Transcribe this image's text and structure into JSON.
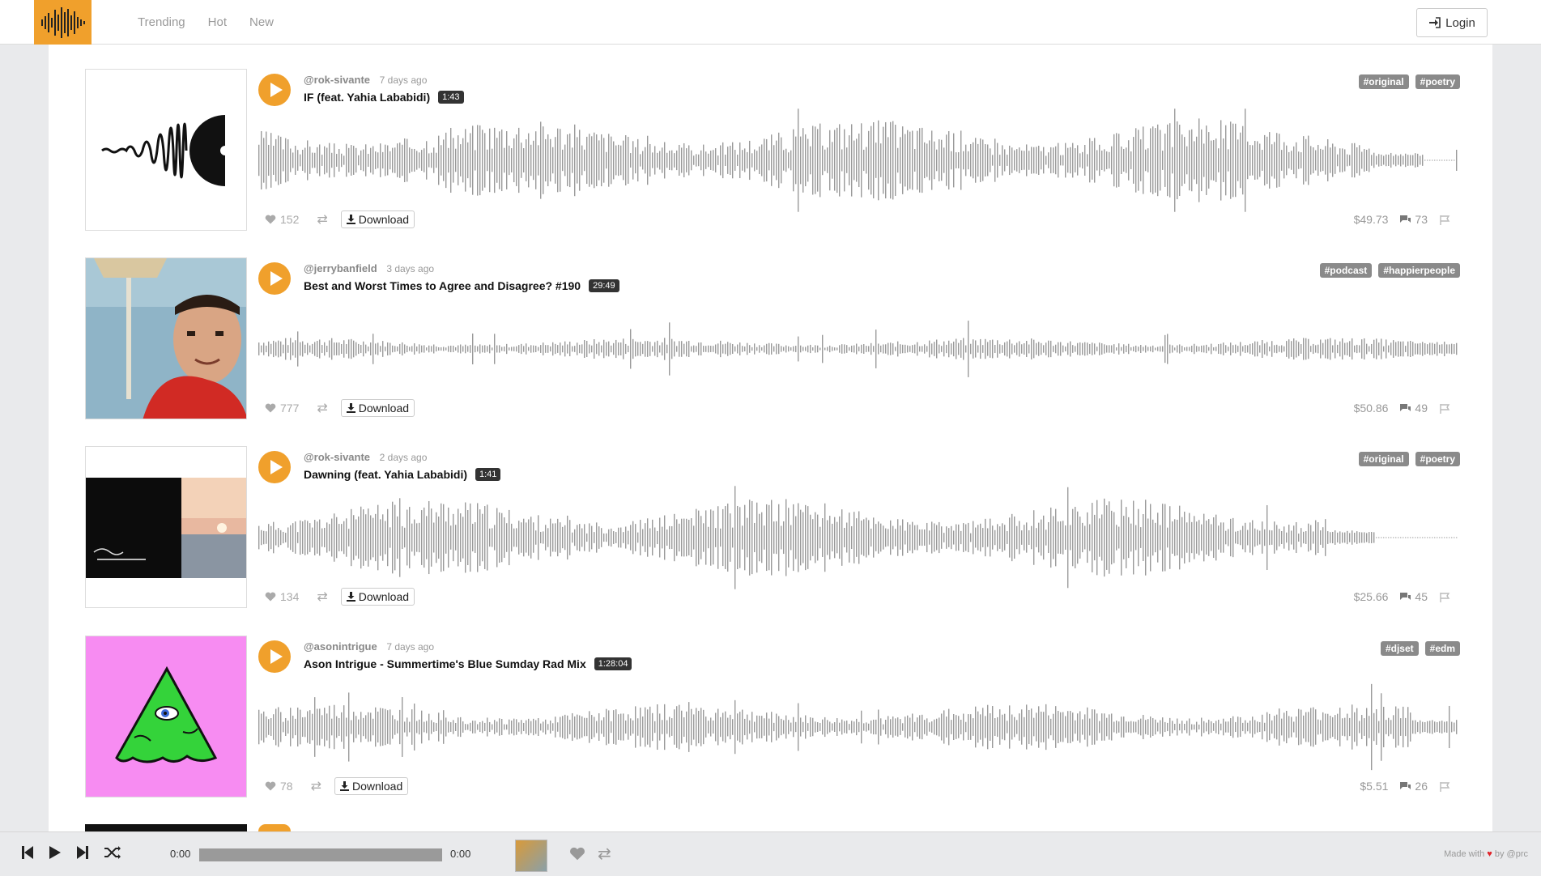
{
  "nav": {
    "items": [
      "Trending",
      "Hot",
      "New"
    ],
    "login_label": "Login"
  },
  "tracks": [
    {
      "author": "@rok-sivante",
      "ago": "7 days ago",
      "title": "IF (feat. Yahia Lababidi)",
      "duration": "1:43",
      "tags": [
        "#original",
        "#poetry"
      ],
      "likes": "152",
      "payout": "$49.73",
      "comments": "73",
      "download_label": "Download",
      "cover": "vinyl-waveform-art"
    },
    {
      "author": "@jerrybanfield",
      "ago": "3 days ago",
      "title": "Best and Worst Times to Agree and Disagree? #190",
      "duration": "29:49",
      "tags": [
        "#podcast",
        "#happierpeople"
      ],
      "likes": "777",
      "payout": "$50.86",
      "comments": "49",
      "download_label": "Download",
      "cover": "man-portrait-photo"
    },
    {
      "author": "@rok-sivante",
      "ago": "2 days ago",
      "title": "Dawning (feat. Yahia Lababidi)",
      "duration": "1:41",
      "tags": [
        "#original",
        "#poetry"
      ],
      "likes": "134",
      "payout": "$25.66",
      "comments": "45",
      "download_label": "Download",
      "cover": "dawning-sunset-art"
    },
    {
      "author": "@asonintrigue",
      "ago": "7 days ago",
      "title": "Ason Intrigue - Summertime's Blue Sumday Rad Mix",
      "duration": "1:28:04",
      "tags": [
        "#djset",
        "#edm"
      ],
      "likes": "78",
      "payout": "$5.51",
      "comments": "26",
      "download_label": "Download",
      "cover": "green-pyramid-eye-art"
    }
  ],
  "player": {
    "current_time": "0:00",
    "total_time": "0:00",
    "made_with": "Made with",
    "by": "by @prc"
  },
  "colors": {
    "accent": "#f0a02c",
    "wave": "#9a9a9a",
    "tag": "#8a8a8a"
  }
}
